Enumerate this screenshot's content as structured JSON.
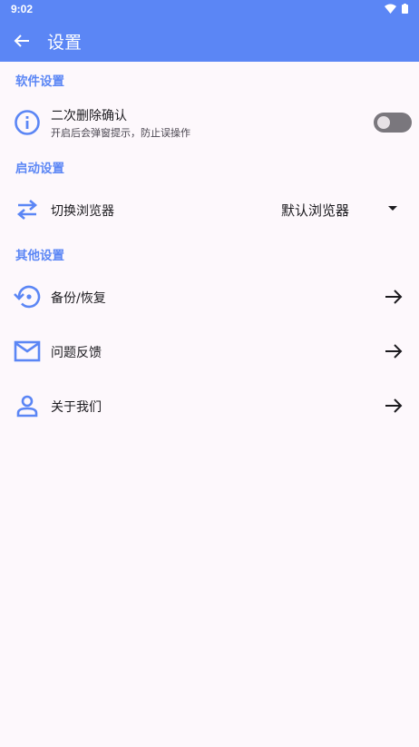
{
  "status_bar": {
    "time": "9:02"
  },
  "app_bar": {
    "title": "设置"
  },
  "sections": {
    "software": {
      "header": "软件设置",
      "confirm_delete": {
        "title": "二次删除确认",
        "subtitle": "开启后会弹窗提示，防止误操作",
        "enabled": false
      }
    },
    "launch": {
      "header": "启动设置",
      "switch_browser": {
        "title": "切换浏览器",
        "selected": "默认浏览器"
      }
    },
    "other": {
      "header": "其他设置",
      "items": [
        {
          "title": "备份/恢复",
          "icon": "backup-restore-icon"
        },
        {
          "title": "问题反馈",
          "icon": "mail-icon"
        },
        {
          "title": "关于我们",
          "icon": "person-icon"
        }
      ]
    }
  },
  "colors": {
    "accent": "#5b86f5",
    "background": "#fdf8fc",
    "toggle_off": "#7a777d"
  }
}
